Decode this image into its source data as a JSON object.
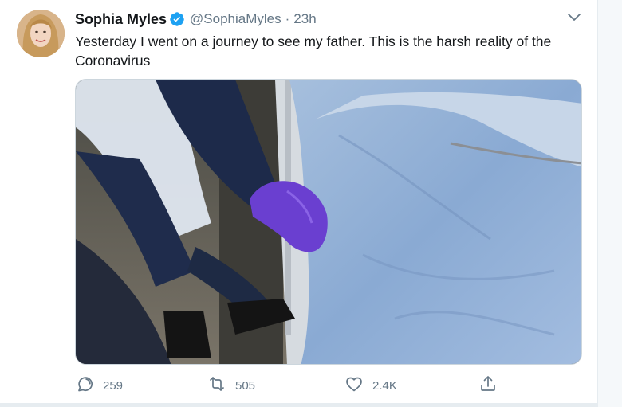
{
  "author": {
    "display_name": "Sophia Myles",
    "handle": "@SophiaMyles",
    "separator": "·",
    "timestamp": "23h",
    "verified": true
  },
  "tweet": {
    "text": "Yesterday I went on a journey to see my father. This is the harsh reality of the Coronavirus"
  },
  "actions": {
    "reply_count": "259",
    "retweet_count": "505",
    "like_count": "2.4K"
  },
  "icons": {
    "verified": "verified-badge-icon",
    "more": "chevron-down-icon",
    "reply": "reply-icon",
    "retweet": "retweet-icon",
    "like": "heart-icon",
    "share": "share-icon"
  },
  "colors": {
    "verified": "#1da1f2",
    "secondary_text": "#657786",
    "primary_text": "#14171a",
    "glove": "#6a3fd0",
    "sheet": "#8fb0d6"
  }
}
